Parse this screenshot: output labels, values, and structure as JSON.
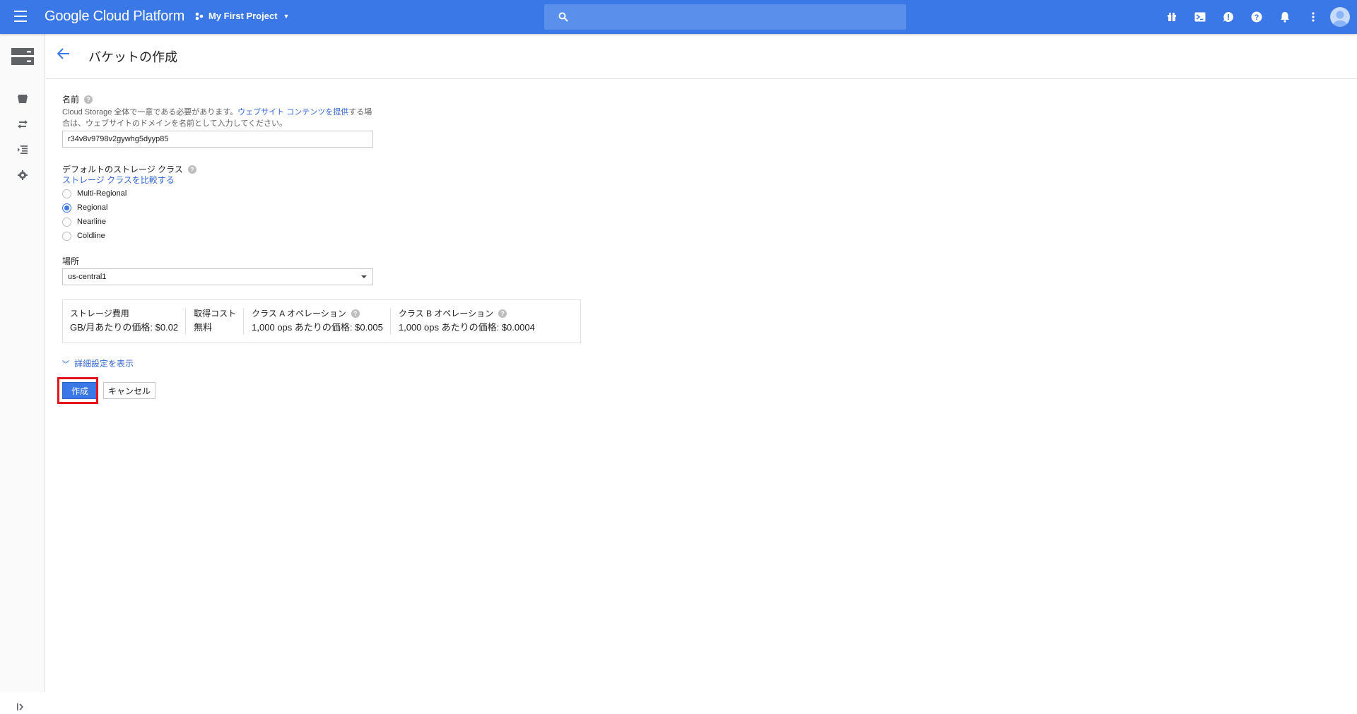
{
  "topbar": {
    "brand": "Google Cloud Platform",
    "project": "My First Project",
    "search_placeholder": ""
  },
  "header": {
    "title": "バケットの作成"
  },
  "name_field": {
    "label": "名前",
    "hint_prefix": "Cloud Storage 全体で一意である必要があります。",
    "hint_link": "ウェブサイト コンテンツを提供",
    "hint_suffix": "する場合は、ウェブサイトのドメインを名前として入力してください。",
    "value": "r34v8v9798v2gywhg5dyyp85"
  },
  "storage_class": {
    "label": "デフォルトのストレージ クラス",
    "compare_link": "ストレージ クラスを比較する",
    "options": [
      {
        "label": "Multi-Regional",
        "checked": false
      },
      {
        "label": "Regional",
        "checked": true
      },
      {
        "label": "Nearline",
        "checked": false
      },
      {
        "label": "Coldline",
        "checked": false
      }
    ]
  },
  "location": {
    "label": "場所",
    "value": "us-central1"
  },
  "pricing": {
    "storage_cost_label": "ストレージ費用",
    "storage_cost_value": "GB/月あたりの価格: $0.02",
    "retrieval_label": "取得コスト",
    "retrieval_value": "無料",
    "class_a_label": "クラス A オペレーション",
    "class_a_value": "1,000 ops あたりの価格: $0.005",
    "class_b_label": "クラス B オペレーション",
    "class_b_value": "1,000 ops あたりの価格: $0.0004"
  },
  "advanced_link": "詳細設定を表示",
  "actions": {
    "create": "作成",
    "cancel": "キャンセル"
  },
  "colors": {
    "brand_blue": "#3b78e7",
    "link_blue": "#3367d6",
    "highlight_red": "#e4141b"
  }
}
